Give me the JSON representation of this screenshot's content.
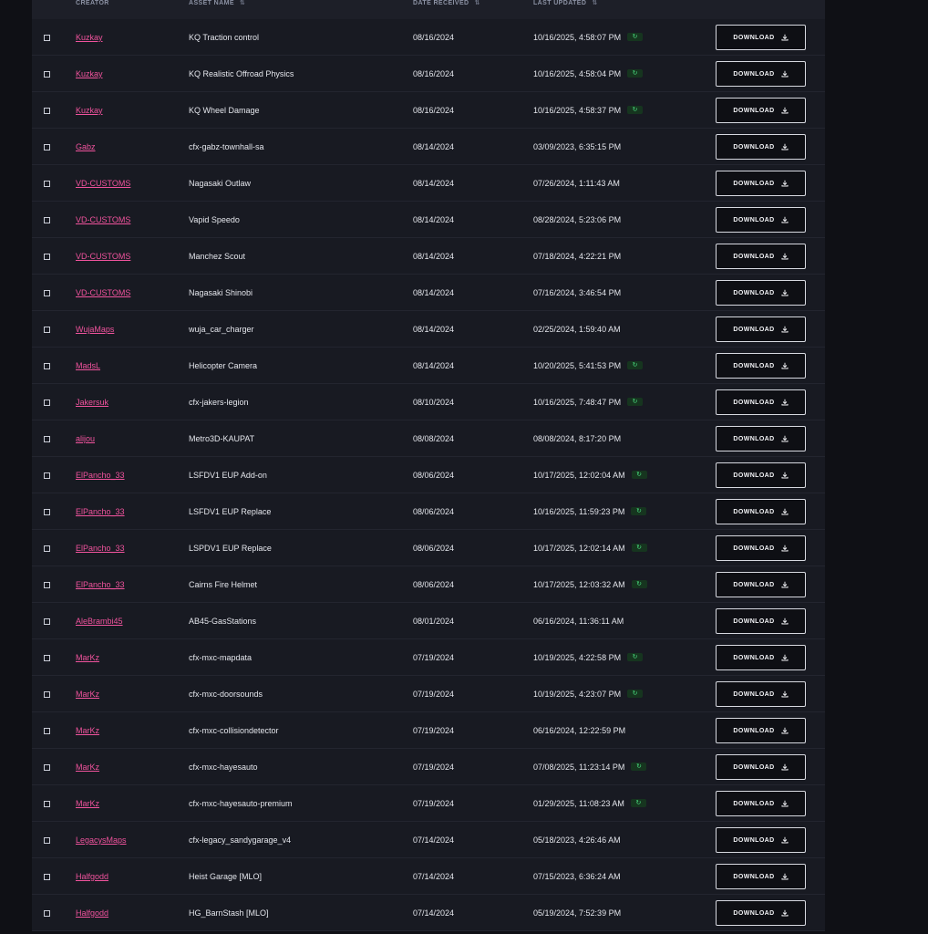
{
  "table": {
    "columns": {
      "creator": "CREATOR",
      "asset_name": "ASSET NAME",
      "date_received": "DATE RECEIVED",
      "last_updated": "LAST UPDATED"
    },
    "sort_glyph": "⇅",
    "update_badge_glyph": "↻",
    "download_label": "DOWNLOAD",
    "colors": {
      "creator_link": "#f0539d",
      "badge_bg": "#16351f",
      "badge_fg": "#4ade80",
      "panel_bg": "#181a22",
      "page_bg": "#0f1015"
    },
    "rows": [
      {
        "creator": "Kuzkay",
        "asset": "KQ Traction control",
        "received": "08/16/2024",
        "updated": "10/16/2025, 4:58:07 PM",
        "badge": true
      },
      {
        "creator": "Kuzkay",
        "asset": "KQ Realistic Offroad Physics",
        "received": "08/16/2024",
        "updated": "10/16/2025, 4:58:04 PM",
        "badge": true
      },
      {
        "creator": "Kuzkay",
        "asset": "KQ Wheel Damage",
        "received": "08/16/2024",
        "updated": "10/16/2025, 4:58:37 PM",
        "badge": true
      },
      {
        "creator": "Gabz",
        "asset": "cfx-gabz-townhall-sa",
        "received": "08/14/2024",
        "updated": "03/09/2023, 6:35:15 PM",
        "badge": false
      },
      {
        "creator": "VD-CUSTOMS",
        "asset": "Nagasaki Outlaw",
        "received": "08/14/2024",
        "updated": "07/26/2024, 1:11:43 AM",
        "badge": false
      },
      {
        "creator": "VD-CUSTOMS",
        "asset": "Vapid Speedo",
        "received": "08/14/2024",
        "updated": "08/28/2024, 5:23:06 PM",
        "badge": false
      },
      {
        "creator": "VD-CUSTOMS",
        "asset": "Manchez Scout",
        "received": "08/14/2024",
        "updated": "07/18/2024, 4:22:21 PM",
        "badge": false
      },
      {
        "creator": "VD-CUSTOMS",
        "asset": "Nagasaki Shinobi",
        "received": "08/14/2024",
        "updated": "07/16/2024, 3:46:54 PM",
        "badge": false
      },
      {
        "creator": "WujaMaps",
        "asset": "wuja_car_charger",
        "received": "08/14/2024",
        "updated": "02/25/2024, 1:59:40 AM",
        "badge": false
      },
      {
        "creator": "MadsL",
        "asset": "Helicopter Camera",
        "received": "08/14/2024",
        "updated": "10/20/2025, 5:41:53 PM",
        "badge": true
      },
      {
        "creator": "Jakersuk",
        "asset": "cfx-jakers-legion",
        "received": "08/10/2024",
        "updated": "10/16/2025, 7:48:47 PM",
        "badge": true
      },
      {
        "creator": "alijou",
        "asset": "Metro3D-KAUPAT",
        "received": "08/08/2024",
        "updated": "08/08/2024, 8:17:20 PM",
        "badge": false
      },
      {
        "creator": "ElPancho_33",
        "asset": "LSFDV1 EUP Add-on",
        "received": "08/06/2024",
        "updated": "10/17/2025, 12:02:04 AM",
        "badge": true
      },
      {
        "creator": "ElPancho_33",
        "asset": "LSFDV1 EUP Replace",
        "received": "08/06/2024",
        "updated": "10/16/2025, 11:59:23 PM",
        "badge": true
      },
      {
        "creator": "ElPancho_33",
        "asset": "LSPDV1 EUP Replace",
        "received": "08/06/2024",
        "updated": "10/17/2025, 12:02:14 AM",
        "badge": true
      },
      {
        "creator": "ElPancho_33",
        "asset": "Cairns Fire Helmet",
        "received": "08/06/2024",
        "updated": "10/17/2025, 12:03:32 AM",
        "badge": true
      },
      {
        "creator": "AleBrambi45",
        "asset": "AB45-GasStations",
        "received": "08/01/2024",
        "updated": "06/16/2024, 11:36:11 AM",
        "badge": false
      },
      {
        "creator": "MarKz",
        "asset": "cfx-mxc-mapdata",
        "received": "07/19/2024",
        "updated": "10/19/2025, 4:22:58 PM",
        "badge": true
      },
      {
        "creator": "MarKz",
        "asset": "cfx-mxc-doorsounds",
        "received": "07/19/2024",
        "updated": "10/19/2025, 4:23:07 PM",
        "badge": true
      },
      {
        "creator": "MarKz",
        "asset": "cfx-mxc-collisiondetector",
        "received": "07/19/2024",
        "updated": "06/16/2024, 12:22:59 PM",
        "badge": false
      },
      {
        "creator": "MarKz",
        "asset": "cfx-mxc-hayesauto",
        "received": "07/19/2024",
        "updated": "07/08/2025, 11:23:14 PM",
        "badge": true
      },
      {
        "creator": "MarKz",
        "asset": "cfx-mxc-hayesauto-premium",
        "received": "07/19/2024",
        "updated": "01/29/2025, 11:08:23 AM",
        "badge": true
      },
      {
        "creator": "LegacysMaps",
        "asset": "cfx-legacy_sandygarage_v4",
        "received": "07/14/2024",
        "updated": "05/18/2023, 4:26:46 AM",
        "badge": false
      },
      {
        "creator": "Halfgodd",
        "asset": "Heist Garage [MLO]",
        "received": "07/14/2024",
        "updated": "07/15/2023, 6:36:24 AM",
        "badge": false
      },
      {
        "creator": "Halfgodd",
        "asset": "HG_BarnStash [MLO]",
        "received": "07/14/2024",
        "updated": "05/19/2024, 7:52:39 PM",
        "badge": false
      }
    ]
  }
}
